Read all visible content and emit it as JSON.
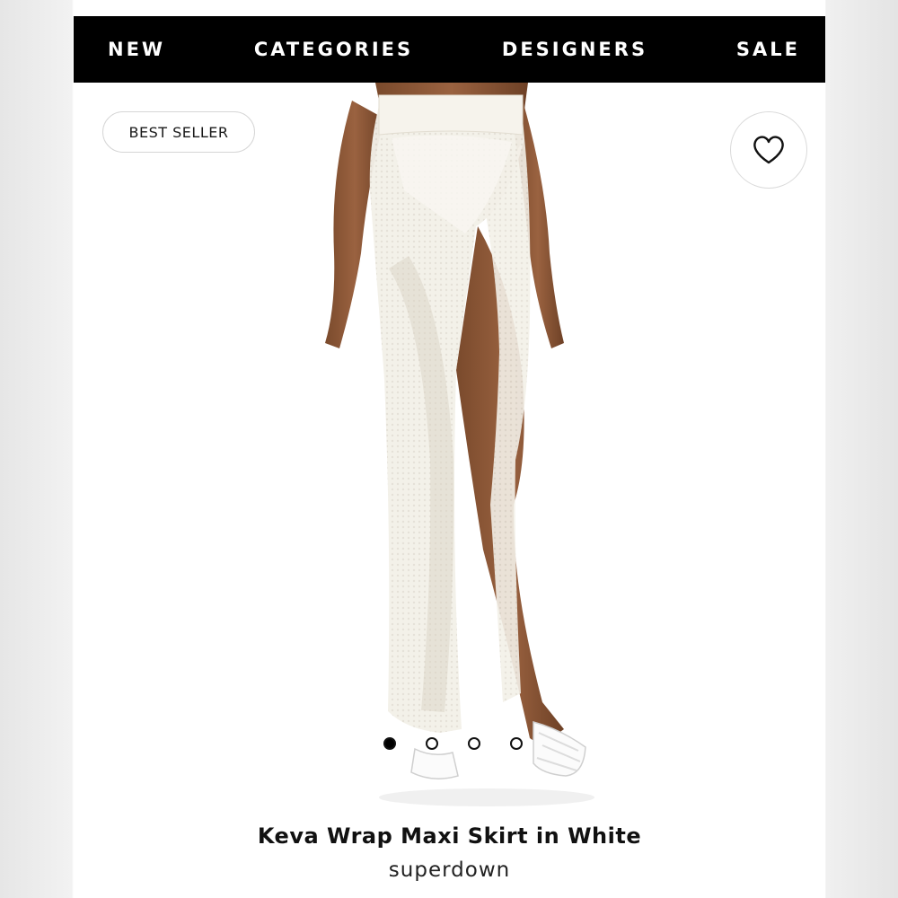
{
  "nav": {
    "items": [
      "NEW",
      "CATEGORIES",
      "DESIGNERS",
      "SALE"
    ]
  },
  "badge": {
    "label": "BEST SELLER"
  },
  "wishlist": {
    "icon": "heart-outline-icon"
  },
  "carousel": {
    "total": 4,
    "active": 1
  },
  "product": {
    "name": "Keva Wrap Maxi Skirt in White",
    "brand": "superdown"
  },
  "colors": {
    "nav_bg": "#000000",
    "nav_text": "#ffffff",
    "skirt": "#f4f1ea"
  }
}
